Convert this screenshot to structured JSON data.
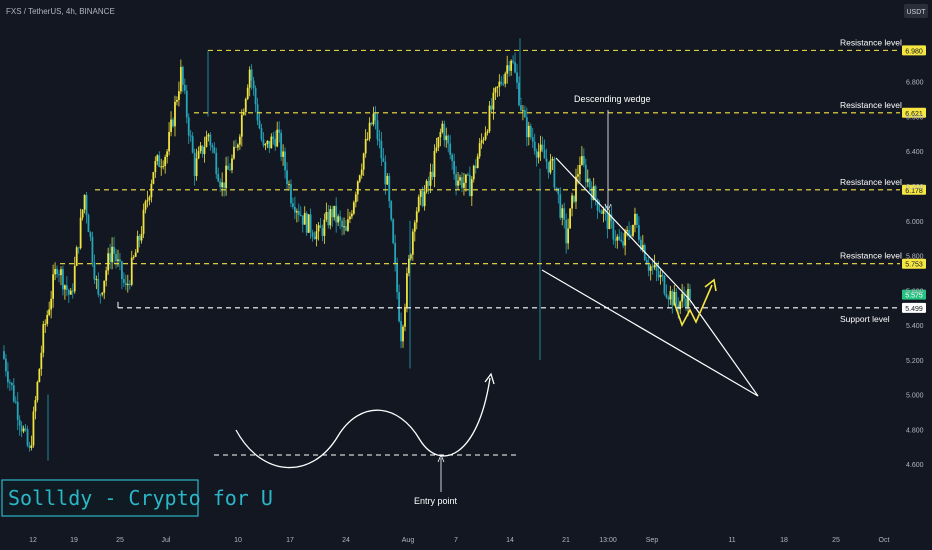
{
  "header": {
    "symbol_line": "FXS / TetherUS, 4h, BINANCE",
    "currency_badge": "USDT"
  },
  "watermark": "Sollldy - Crypto for U",
  "colors": {
    "background": "#131722",
    "candle_up": "#f0e441",
    "candle_down": "#26a5b8",
    "resistance_line": "#f5e642",
    "support_line": "#ffffff",
    "annotation": "#ffffff",
    "arrow": "#f5e642",
    "watermark_text": "#2bb7c7"
  },
  "chart_data": {
    "type": "candlestick",
    "title": "FXS / TetherUS, 4h, BINANCE",
    "xlabel": "",
    "ylabel": "USDT",
    "ylim": [
      4.48,
      7.08
    ],
    "grid": false,
    "y_ticks": [
      "6.800",
      "6.600",
      "6.400",
      "6.200",
      "6.000",
      "5.800",
      "5.600",
      "5.400",
      "5.200",
      "5.000",
      "4.800",
      "4.600"
    ],
    "x_ticks": [
      "12",
      "19",
      "25",
      "Jul",
      "10",
      "17",
      "24",
      "Aug",
      "7",
      "14",
      "21",
      "13:00",
      "Sep",
      "11",
      "18",
      "25",
      "Oct"
    ],
    "price_path": [
      [
        "12",
        5.25
      ],
      [
        "15",
        4.95
      ],
      [
        "17",
        4.66
      ],
      [
        "19",
        5.35
      ],
      [
        "21",
        5.75
      ],
      [
        "23",
        5.55
      ],
      [
        "24",
        6.15
      ],
      [
        "25",
        5.55
      ],
      [
        "27",
        5.85
      ],
      [
        "28",
        5.6
      ],
      [
        "Jul",
        5.9
      ],
      [
        "Jul 3",
        6.3
      ],
      [
        "Jul 6",
        6.4
      ],
      [
        "Jul 7",
        6.85
      ],
      [
        "Jul 9",
        6.3
      ],
      [
        "10",
        6.5
      ],
      [
        "12",
        6.2
      ],
      [
        "14",
        6.4
      ],
      [
        "15",
        6.88
      ],
      [
        "16",
        6.4
      ],
      [
        "18",
        6.5
      ],
      [
        "20",
        6.15
      ],
      [
        "22",
        6.0
      ],
      [
        "24",
        5.92
      ],
      [
        "26",
        6.05
      ],
      [
        "28",
        5.92
      ],
      [
        "30",
        6.3
      ],
      [
        "31",
        6.6
      ],
      [
        "Aug",
        6.2
      ],
      [
        "Aug 2",
        5.35
      ],
      [
        "Aug 3",
        6.05
      ],
      [
        "Aug 5",
        6.2
      ],
      [
        "Aug 6",
        6.55
      ],
      [
        "7",
        6.25
      ],
      [
        "9",
        6.2
      ],
      [
        "11",
        6.5
      ],
      [
        "13",
        6.75
      ],
      [
        "14",
        6.95
      ],
      [
        "15",
        6.55
      ],
      [
        "17",
        6.4
      ],
      [
        "19",
        6.3
      ],
      [
        "20",
        5.9
      ],
      [
        "21",
        6.35
      ],
      [
        "22",
        6.15
      ],
      [
        "24",
        6.0
      ],
      [
        "26",
        5.85
      ],
      [
        "28",
        6.0
      ],
      [
        "30",
        5.75
      ],
      [
        "Sep",
        5.65
      ],
      [
        "Sep 2",
        5.52
      ],
      [
        "Sep 3",
        5.58
      ]
    ],
    "levels": [
      {
        "label": "Resistance level",
        "value": 6.98,
        "price_tag": "6.980",
        "kind": "resistance"
      },
      {
        "label": "Resistance level",
        "value": 6.621,
        "price_tag": "6.621",
        "kind": "resistance"
      },
      {
        "label": "Resistance level",
        "value": 6.178,
        "price_tag": "6.178",
        "kind": "resistance"
      },
      {
        "label": "Resistance level",
        "value": 5.753,
        "price_tag": "5.753",
        "kind": "resistance"
      },
      {
        "label": "Support level",
        "value": 5.499,
        "price_tag": "5.499",
        "kind": "support"
      }
    ],
    "current_price": {
      "value": 5.575,
      "label": "5.575"
    },
    "annotations": {
      "wedge_label": "Descending wedge",
      "entry_label": "Entry point"
    }
  }
}
